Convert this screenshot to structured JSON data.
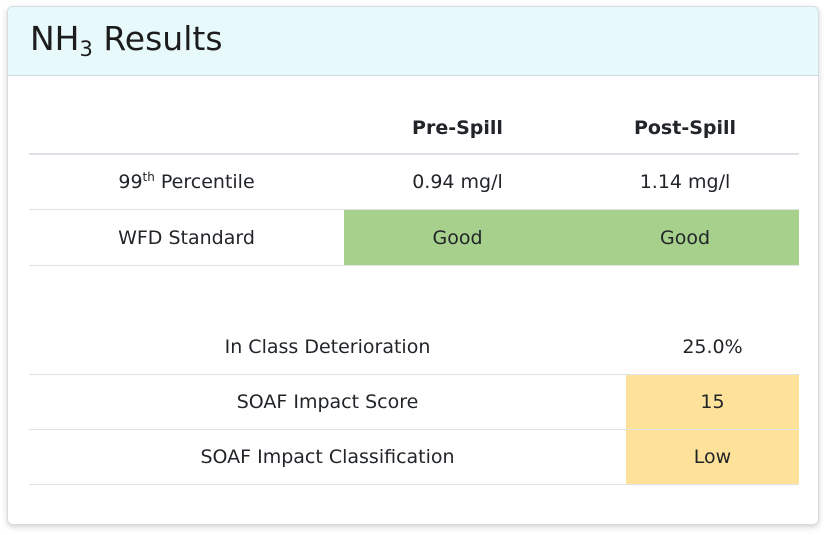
{
  "header": {
    "title_prefix": "NH",
    "title_sub": "3",
    "title_suffix": " Results"
  },
  "spill_table": {
    "columns": [
      "",
      "Pre-Spill",
      "Post-Spill"
    ],
    "percentile_row": {
      "label_prefix": "99",
      "label_sup": "th",
      "label_suffix": " Percentile",
      "pre": "0.94 mg/l",
      "post": "1.14 mg/l"
    },
    "wfd_row": {
      "label": "WFD Standard",
      "pre": "Good",
      "post": "Good",
      "status_color": "#a8d08d"
    }
  },
  "impact_table": {
    "rows": [
      {
        "label": "In Class Deterioration",
        "value": "25.0%"
      },
      {
        "label": "SOAF Impact Score",
        "value": "15",
        "highlight_color": "#ffe299"
      },
      {
        "label": "SOAF Impact Classification",
        "value": "Low",
        "highlight_color": "#ffe299"
      }
    ]
  }
}
